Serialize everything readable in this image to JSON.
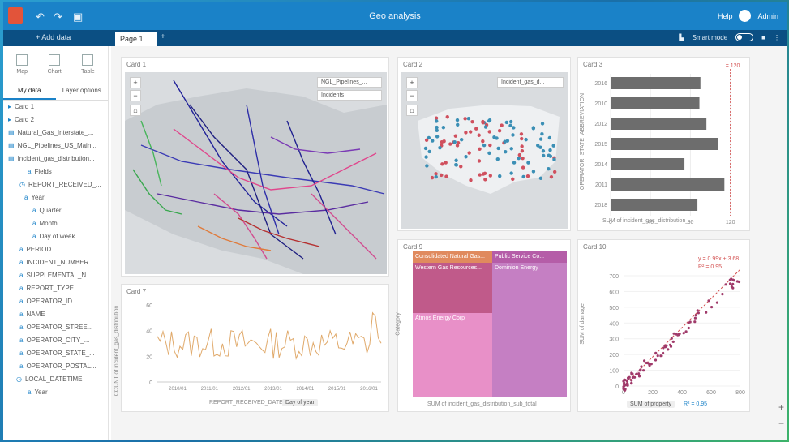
{
  "titlebar": {
    "title": "Geo analysis",
    "user_menu": "Help",
    "user_name": "Admin"
  },
  "tabbar": {
    "add_data": "+ Add data",
    "page_tab": "Page 1",
    "tab_add": "+",
    "right_label": "Smart mode"
  },
  "sidebar": {
    "tools": [
      {
        "label": "Map"
      },
      {
        "label": "Chart"
      },
      {
        "label": "Table"
      }
    ],
    "tabs": [
      "My data",
      "Layer options"
    ],
    "items": [
      {
        "label": "Card 1",
        "icon": "triangle-icon"
      },
      {
        "label": "Card 2",
        "icon": "triangle-icon"
      },
      {
        "label": "Natural_Gas_Interstate_...",
        "icon": "table-icon"
      },
      {
        "label": "NGL_Pipelines_US_Main...",
        "icon": "table-icon"
      },
      {
        "label": "Incident_gas_distribution...",
        "icon": "table-icon"
      },
      {
        "label": "Fields",
        "icon": "field-icon"
      },
      {
        "label": "REPORT_RECEIVED_...",
        "icon": "calendar-icon"
      },
      {
        "label": "Year",
        "icon": "field-icon"
      },
      {
        "label": "Quarter",
        "icon": "field-icon"
      },
      {
        "label": "Month",
        "icon": "field-icon"
      },
      {
        "label": "Day of week",
        "icon": "field-icon"
      },
      {
        "label": "PERIOD",
        "icon": "field-icon"
      },
      {
        "label": "INCIDENT_NUMBER",
        "icon": "field-icon"
      },
      {
        "label": "SUPPLEMENTAL_N...",
        "icon": "field-icon"
      },
      {
        "label": "REPORT_TYPE",
        "icon": "field-icon"
      },
      {
        "label": "OPERATOR_ID",
        "icon": "field-icon"
      },
      {
        "label": "NAME",
        "icon": "field-icon"
      },
      {
        "label": "OPERATOR_STREE...",
        "icon": "field-icon"
      },
      {
        "label": "OPERATOR_CITY_...",
        "icon": "field-icon"
      },
      {
        "label": "OPERATOR_STATE_...",
        "icon": "field-icon"
      },
      {
        "label": "OPERATOR_POSTAL...",
        "icon": "field-icon"
      },
      {
        "label": "LOCAL_DATETIME",
        "icon": "calendar-icon"
      },
      {
        "label": "Year",
        "icon": "field-icon"
      }
    ]
  },
  "cards": {
    "card1": {
      "title": "Card 1",
      "legend1": "NGL_Pipelines_...",
      "legend2": "Incidents"
    },
    "card2": {
      "title": "Card 2",
      "legend1": "Incident_gas_d..."
    },
    "card3": {
      "title": "Card 3",
      "xlabel": "SUM of incident_gas_distribution_...",
      "ylabel": "OPERATOR_STATE_ABBREVIATION",
      "ref_label": "= 120",
      "chart_data": {
        "type": "bar",
        "categories": [
          "2016",
          "2010",
          "2012",
          "2015",
          "2014",
          "2011",
          "2018"
        ],
        "values": [
          90,
          89,
          96,
          108,
          74,
          114,
          87
        ],
        "xlim": [
          0,
          130
        ],
        "xticks": [
          "0",
          "40",
          "80",
          "120"
        ]
      }
    },
    "card7": {
      "title": "Card 7",
      "xlabel": "REPORT_RECEIVED_DATE",
      "interval": "Day of year",
      "ylabel": "COUNT of incident_gas_distribution",
      "yticks": [
        "60",
        "40",
        "20",
        "0"
      ],
      "xticks": [
        "2010/01",
        "2011/01",
        "2012/01",
        "2013/01",
        "2014/01",
        "2015/01",
        "2016/01"
      ]
    },
    "card9": {
      "title": "Card 9",
      "xlabel": "SUM of incident_gas_distribution_sub_total",
      "ylabel": "Category",
      "cells": [
        {
          "label": "Consolidated Natural Gas...",
          "color": "#e08a5e"
        },
        {
          "label": "Western Gas Resources...",
          "color": "#c05a8a"
        },
        {
          "label": "Public Service Co...",
          "color": "#b55da8"
        },
        {
          "label": "Atmos Energy Corp",
          "color": "#e890c8"
        },
        {
          "label": "Dominion Energy",
          "color": "#c57fc3"
        }
      ]
    },
    "card10": {
      "title": "Card 10",
      "eq1": "y = 0.99x + 3.68",
      "eq2": "R² = 0.95",
      "xlabel": "SUM of property",
      "ylabel": "SUM of damage",
      "r_label": "R² = 0.95",
      "yticks": [
        "700",
        "600",
        "500",
        "400",
        "300",
        "200",
        "100",
        "0"
      ],
      "xticks": [
        "0",
        "200",
        "400",
        "600",
        "800"
      ]
    }
  }
}
